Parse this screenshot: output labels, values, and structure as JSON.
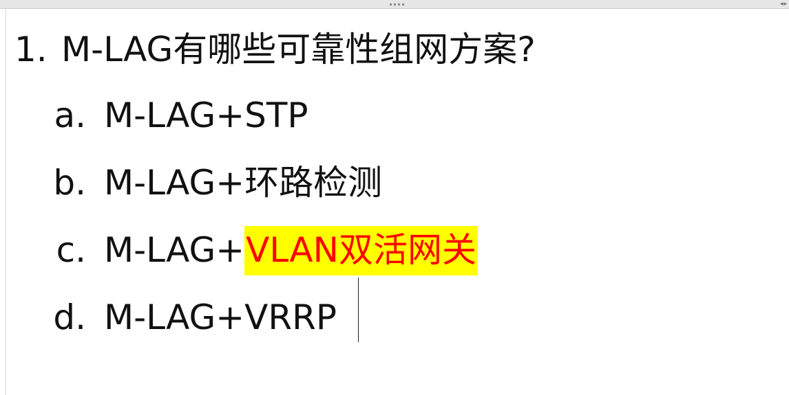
{
  "question": {
    "number": "1.",
    "text": "M-LAG有哪些可靠性组网方案?"
  },
  "options": [
    {
      "marker": "a.",
      "text": "M-LAG+STP"
    },
    {
      "marker": "b.",
      "text": "M-LAG+环路检测"
    },
    {
      "marker": "c.",
      "text_plain": "M-LAG+",
      "text_highlight": "VLAN双活网关"
    },
    {
      "marker": "d.",
      "text": "M-LAG+VRRP"
    }
  ],
  "colors": {
    "highlight_background": "#ffff00",
    "highlight_text": "#ff0000",
    "text": "#111111"
  },
  "icons": {
    "grip": "drag-grip-icon",
    "arrows": "left-right-arrows-icon"
  }
}
